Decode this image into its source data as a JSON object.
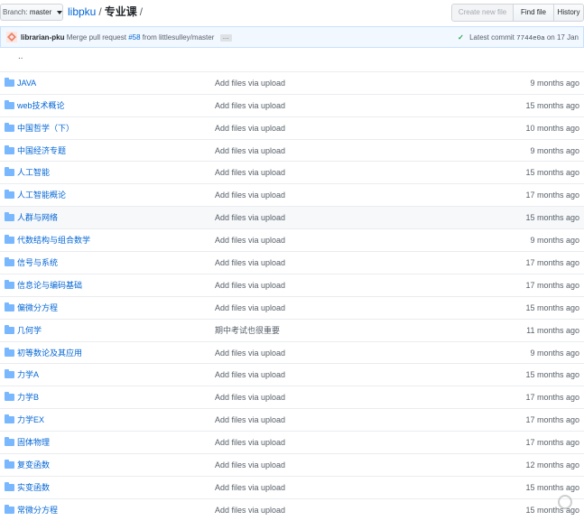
{
  "header": {
    "branch_label": "Branch:",
    "branch_name": "master",
    "repo": "libpku",
    "separator": "/",
    "current_dir": "专业课",
    "trailing_separator": "/",
    "buttons": {
      "create_new_file": "Create new file",
      "find_file": "Find file",
      "history": "History"
    }
  },
  "commit": {
    "author": "librarian-pku",
    "message_prefix": "Merge pull request",
    "pr": "#58",
    "message_suffix": "from littlesulley/master",
    "ellipsis": "…",
    "latest_label": "Latest commit",
    "sha": "7744e0a",
    "date": "on 17 Jan"
  },
  "parent_dir": "..",
  "files": [
    {
      "name": "JAVA",
      "message": "Add files via upload",
      "age": "9 months ago"
    },
    {
      "name": "web技术概论",
      "message": "Add files via upload",
      "age": "15 months ago"
    },
    {
      "name": "中国哲学（下）",
      "message": "Add files via upload",
      "age": "10 months ago"
    },
    {
      "name": "中国经济专题",
      "message": "Add files via upload",
      "age": "9 months ago"
    },
    {
      "name": "人工智能",
      "message": "Add files via upload",
      "age": "15 months ago"
    },
    {
      "name": "人工智能概论",
      "message": "Add files via upload",
      "age": "17 months ago"
    },
    {
      "name": "人群与网络",
      "message": "Add files via upload",
      "age": "15 months ago"
    },
    {
      "name": "代数结构与组合数学",
      "message": "Add files via upload",
      "age": "9 months ago"
    },
    {
      "name": "信号与系统",
      "message": "Add files via upload",
      "age": "17 months ago"
    },
    {
      "name": "信息论与编码基础",
      "message": "Add files via upload",
      "age": "17 months ago"
    },
    {
      "name": "偏微分方程",
      "message": "Add files via upload",
      "age": "15 months ago"
    },
    {
      "name": "几何学",
      "message": "期中考试也很重要",
      "age": "11 months ago"
    },
    {
      "name": "初等数论及其应用",
      "message": "Add files via upload",
      "age": "9 months ago"
    },
    {
      "name": "力学A",
      "message": "Add files via upload",
      "age": "15 months ago"
    },
    {
      "name": "力学B",
      "message": "Add files via upload",
      "age": "17 months ago"
    },
    {
      "name": "力学EX",
      "message": "Add files via upload",
      "age": "17 months ago"
    },
    {
      "name": "固体物理",
      "message": "Add files via upload",
      "age": "17 months ago"
    },
    {
      "name": "复变函数",
      "message": "Add files via upload",
      "age": "12 months ago"
    },
    {
      "name": "实变函数",
      "message": "Add files via upload",
      "age": "15 months ago"
    },
    {
      "name": "常微分方程",
      "message": "Add files via upload",
      "age": "15 months ago"
    }
  ],
  "colors": {
    "link": "#0366d6",
    "muted": "#586069",
    "folder": "#79b8ff",
    "commit_bg": "#f1f8ff",
    "success": "#28a745"
  },
  "icons": {
    "folder": "folder-icon",
    "check": "check-icon",
    "avatar": "avatar"
  }
}
